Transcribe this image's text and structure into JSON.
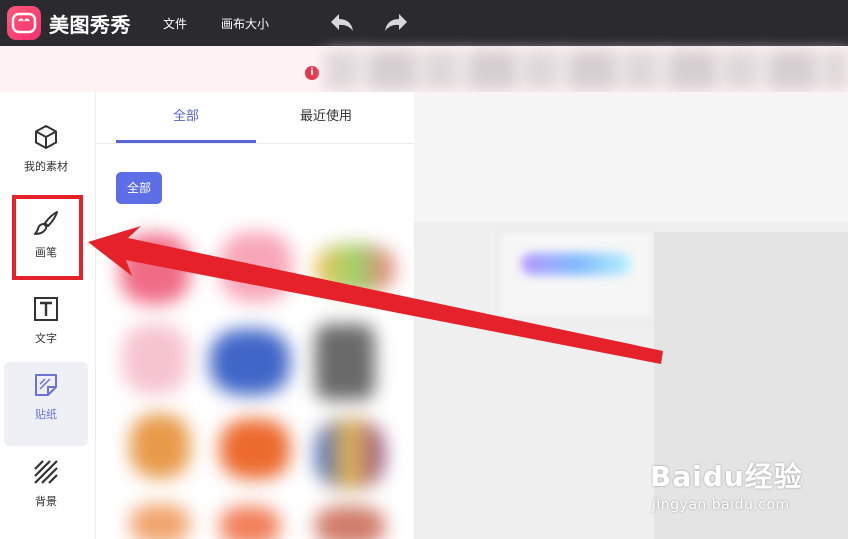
{
  "app": {
    "brand": "美图秀秀"
  },
  "topbar": {
    "menu": [
      "文件",
      "画布大小"
    ],
    "undo_icon": "undo-arrow-icon",
    "redo_icon": "redo-arrow-icon"
  },
  "notice": {
    "icon": "info-icon",
    "icon_glyph": "i"
  },
  "leftnav": {
    "items": [
      {
        "label": "我的素材",
        "icon": "cube-icon"
      },
      {
        "label": "画笔",
        "icon": "brush-icon"
      },
      {
        "label": "文字",
        "icon": "text-t-icon"
      },
      {
        "label": "贴纸",
        "icon": "sticker-icon",
        "active": true
      },
      {
        "label": "背景",
        "icon": "stripes-icon"
      }
    ]
  },
  "panel": {
    "tabs": [
      {
        "label": "全部",
        "active": true
      },
      {
        "label": "最近使用",
        "active": false
      }
    ],
    "filter_chip": "全部"
  },
  "watermark": {
    "main": "Baidu经验",
    "sub": "jingyan.baidu.com"
  },
  "colors": {
    "topbar": "#2b2b2f",
    "accent": "#5a66d8",
    "highlight_red": "#e5222a",
    "notice_bg": "#fff2f3"
  }
}
